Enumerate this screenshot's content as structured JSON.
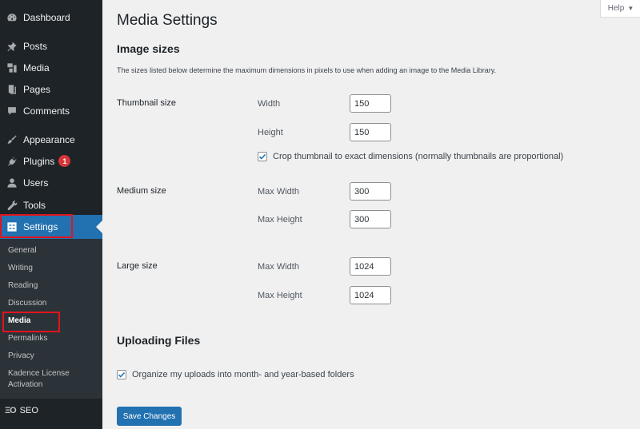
{
  "sidebar": {
    "items": [
      {
        "label": "Dashboard",
        "icon": "dashboard-icon"
      },
      {
        "label": "Posts",
        "icon": "pin-icon"
      },
      {
        "label": "Media",
        "icon": "media-icon"
      },
      {
        "label": "Pages",
        "icon": "pages-icon"
      },
      {
        "label": "Comments",
        "icon": "comment-icon"
      },
      {
        "label": "Appearance",
        "icon": "brush-icon"
      },
      {
        "label": "Plugins",
        "icon": "plugin-icon",
        "badge": "1"
      },
      {
        "label": "Users",
        "icon": "user-icon"
      },
      {
        "label": "Tools",
        "icon": "wrench-icon"
      },
      {
        "label": "Settings",
        "icon": "settings-icon",
        "active": true
      }
    ],
    "submenu": [
      {
        "label": "General"
      },
      {
        "label": "Writing"
      },
      {
        "label": "Reading"
      },
      {
        "label": "Discussion"
      },
      {
        "label": "Media",
        "current": true
      },
      {
        "label": "Permalinks"
      },
      {
        "label": "Privacy"
      },
      {
        "label": "Kadence License"
      },
      {
        "label": "Activation"
      }
    ],
    "seo": {
      "label": "SEO",
      "icon_text": "ΞO"
    }
  },
  "help": {
    "label": "Help",
    "caret": "▼"
  },
  "page": {
    "title": "Media Settings",
    "image_sizes": {
      "heading": "Image sizes",
      "description": "The sizes listed below determine the maximum dimensions in pixels to use when adding an image to the Media Library.",
      "thumbnail": {
        "label": "Thumbnail size",
        "width_label": "Width",
        "width_value": "150",
        "height_label": "Height",
        "height_value": "150",
        "crop_label": "Crop thumbnail to exact dimensions (normally thumbnails are proportional)",
        "crop_checked": true
      },
      "medium": {
        "label": "Medium size",
        "width_label": "Max Width",
        "width_value": "300",
        "height_label": "Max Height",
        "height_value": "300"
      },
      "large": {
        "label": "Large size",
        "width_label": "Max Width",
        "width_value": "1024",
        "height_label": "Max Height",
        "height_value": "1024"
      }
    },
    "uploading": {
      "heading": "Uploading Files",
      "organize_label": "Organize my uploads into month- and year-based folders",
      "organize_checked": true
    },
    "save_label": "Save Changes"
  },
  "colors": {
    "sidebar_bg": "#1d2327",
    "submenu_bg": "#2c3338",
    "accent": "#2271b1",
    "badge": "#d63638",
    "highlight": "#e1141e"
  }
}
